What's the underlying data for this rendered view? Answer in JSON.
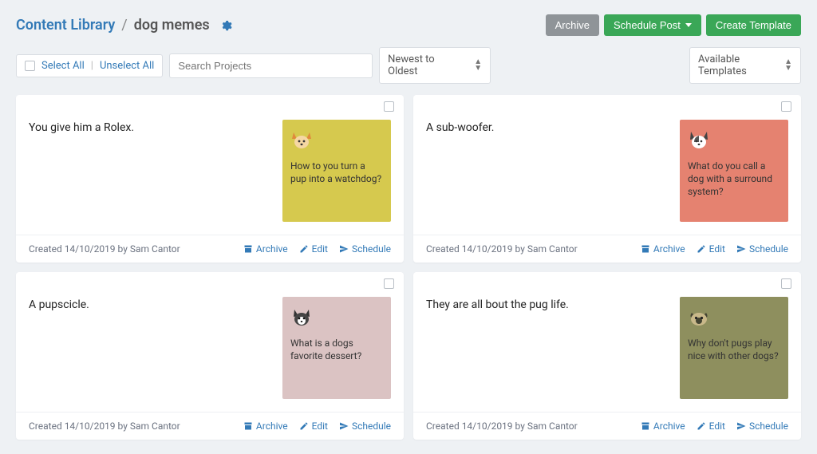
{
  "breadcrumb": {
    "library_label": "Content Library",
    "sep": "/",
    "folder_label": "dog memes"
  },
  "buttons": {
    "archive": "Archive",
    "schedule_post": "Schedule Post",
    "create_template": "Create Template"
  },
  "controls": {
    "select_all": "Select All",
    "unselect_all": "Unselect All",
    "search_placeholder": "Search Projects",
    "sort_label": "Newest to Oldest",
    "templates_label": "Available Templates"
  },
  "card_actions": {
    "archive": "Archive",
    "edit": "Edit",
    "schedule": "Schedule"
  },
  "cards": [
    {
      "text": "You give him a Rolex.",
      "tile_text": "How to you turn a pup into a watchdog?",
      "tile_bg": "#d6c94e",
      "dog_type": "corgi",
      "meta": "Created 14/10/2019 by Sam Cantor"
    },
    {
      "text": "A sub-woofer.",
      "tile_text": "What do you call a dog with a surround system?",
      "tile_bg": "#e58270",
      "dog_type": "terrier",
      "meta": "Created 14/10/2019 by Sam Cantor"
    },
    {
      "text": "A pupscicle.",
      "tile_text": "What is a dogs favorite dessert?",
      "tile_bg": "#dbc3c3",
      "dog_type": "boston",
      "meta": "Created 14/10/2019 by Sam Cantor"
    },
    {
      "text": "They are all bout the pug life.",
      "tile_text": "Why don't pugs play nice with other dogs?",
      "tile_bg": "#8e8f5e",
      "dog_type": "pug",
      "meta": "Created 14/10/2019 by Sam Cantor"
    }
  ]
}
